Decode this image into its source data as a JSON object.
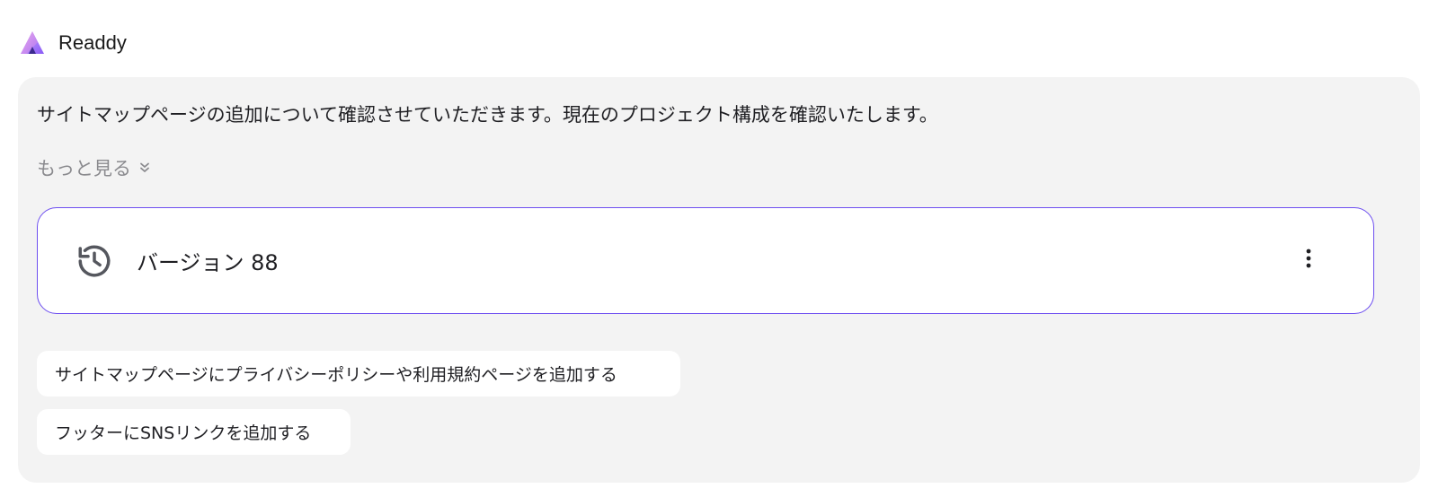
{
  "header": {
    "app_name": "Readdy",
    "logo_icon": "readdy-logo-icon"
  },
  "message": {
    "text": "サイトマップページの追加について確認させていただきます。現在のプロジェクト構成を確認いたします。",
    "more_label": "もっと見る",
    "more_icon": "chevron-double-down-icon"
  },
  "version_card": {
    "icon": "history-icon",
    "label": "バージョン 88",
    "menu_icon": "more-vertical-icon",
    "border_color": "#6d4ef0"
  },
  "suggestions": [
    {
      "label": "サイトマップページにプライバシーポリシーや利用規約ページを追加する"
    },
    {
      "label": "フッターにSNSリンクを追加する"
    }
  ],
  "colors": {
    "card_background": "#f3f3f3",
    "accent": "#6d4ef0",
    "muted_text": "#8a8a8e"
  }
}
